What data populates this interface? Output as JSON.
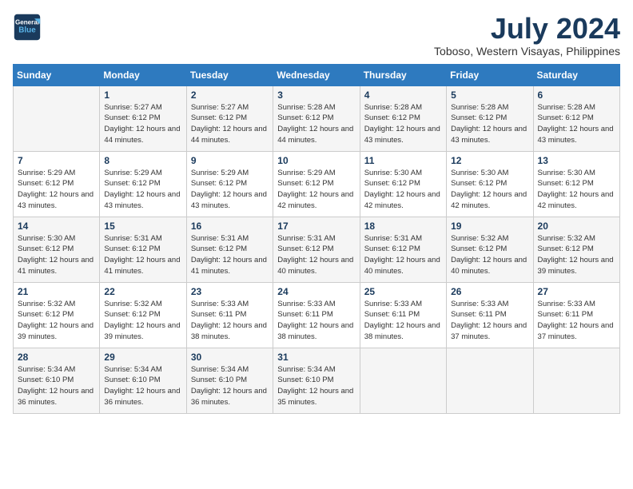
{
  "header": {
    "logo_line1": "General",
    "logo_line2": "Blue",
    "month_year": "July 2024",
    "location": "Toboso, Western Visayas, Philippines"
  },
  "days_of_week": [
    "Sunday",
    "Monday",
    "Tuesday",
    "Wednesday",
    "Thursday",
    "Friday",
    "Saturday"
  ],
  "weeks": [
    [
      {
        "day": "",
        "sunrise": "",
        "sunset": "",
        "daylight": ""
      },
      {
        "day": "1",
        "sunrise": "Sunrise: 5:27 AM",
        "sunset": "Sunset: 6:12 PM",
        "daylight": "Daylight: 12 hours and 44 minutes."
      },
      {
        "day": "2",
        "sunrise": "Sunrise: 5:27 AM",
        "sunset": "Sunset: 6:12 PM",
        "daylight": "Daylight: 12 hours and 44 minutes."
      },
      {
        "day": "3",
        "sunrise": "Sunrise: 5:28 AM",
        "sunset": "Sunset: 6:12 PM",
        "daylight": "Daylight: 12 hours and 44 minutes."
      },
      {
        "day": "4",
        "sunrise": "Sunrise: 5:28 AM",
        "sunset": "Sunset: 6:12 PM",
        "daylight": "Daylight: 12 hours and 43 minutes."
      },
      {
        "day": "5",
        "sunrise": "Sunrise: 5:28 AM",
        "sunset": "Sunset: 6:12 PM",
        "daylight": "Daylight: 12 hours and 43 minutes."
      },
      {
        "day": "6",
        "sunrise": "Sunrise: 5:28 AM",
        "sunset": "Sunset: 6:12 PM",
        "daylight": "Daylight: 12 hours and 43 minutes."
      }
    ],
    [
      {
        "day": "7",
        "sunrise": "Sunrise: 5:29 AM",
        "sunset": "Sunset: 6:12 PM",
        "daylight": "Daylight: 12 hours and 43 minutes."
      },
      {
        "day": "8",
        "sunrise": "Sunrise: 5:29 AM",
        "sunset": "Sunset: 6:12 PM",
        "daylight": "Daylight: 12 hours and 43 minutes."
      },
      {
        "day": "9",
        "sunrise": "Sunrise: 5:29 AM",
        "sunset": "Sunset: 6:12 PM",
        "daylight": "Daylight: 12 hours and 43 minutes."
      },
      {
        "day": "10",
        "sunrise": "Sunrise: 5:29 AM",
        "sunset": "Sunset: 6:12 PM",
        "daylight": "Daylight: 12 hours and 42 minutes."
      },
      {
        "day": "11",
        "sunrise": "Sunrise: 5:30 AM",
        "sunset": "Sunset: 6:12 PM",
        "daylight": "Daylight: 12 hours and 42 minutes."
      },
      {
        "day": "12",
        "sunrise": "Sunrise: 5:30 AM",
        "sunset": "Sunset: 6:12 PM",
        "daylight": "Daylight: 12 hours and 42 minutes."
      },
      {
        "day": "13",
        "sunrise": "Sunrise: 5:30 AM",
        "sunset": "Sunset: 6:12 PM",
        "daylight": "Daylight: 12 hours and 42 minutes."
      }
    ],
    [
      {
        "day": "14",
        "sunrise": "Sunrise: 5:30 AM",
        "sunset": "Sunset: 6:12 PM",
        "daylight": "Daylight: 12 hours and 41 minutes."
      },
      {
        "day": "15",
        "sunrise": "Sunrise: 5:31 AM",
        "sunset": "Sunset: 6:12 PM",
        "daylight": "Daylight: 12 hours and 41 minutes."
      },
      {
        "day": "16",
        "sunrise": "Sunrise: 5:31 AM",
        "sunset": "Sunset: 6:12 PM",
        "daylight": "Daylight: 12 hours and 41 minutes."
      },
      {
        "day": "17",
        "sunrise": "Sunrise: 5:31 AM",
        "sunset": "Sunset: 6:12 PM",
        "daylight": "Daylight: 12 hours and 40 minutes."
      },
      {
        "day": "18",
        "sunrise": "Sunrise: 5:31 AM",
        "sunset": "Sunset: 6:12 PM",
        "daylight": "Daylight: 12 hours and 40 minutes."
      },
      {
        "day": "19",
        "sunrise": "Sunrise: 5:32 AM",
        "sunset": "Sunset: 6:12 PM",
        "daylight": "Daylight: 12 hours and 40 minutes."
      },
      {
        "day": "20",
        "sunrise": "Sunrise: 5:32 AM",
        "sunset": "Sunset: 6:12 PM",
        "daylight": "Daylight: 12 hours and 39 minutes."
      }
    ],
    [
      {
        "day": "21",
        "sunrise": "Sunrise: 5:32 AM",
        "sunset": "Sunset: 6:12 PM",
        "daylight": "Daylight: 12 hours and 39 minutes."
      },
      {
        "day": "22",
        "sunrise": "Sunrise: 5:32 AM",
        "sunset": "Sunset: 6:12 PM",
        "daylight": "Daylight: 12 hours and 39 minutes."
      },
      {
        "day": "23",
        "sunrise": "Sunrise: 5:33 AM",
        "sunset": "Sunset: 6:11 PM",
        "daylight": "Daylight: 12 hours and 38 minutes."
      },
      {
        "day": "24",
        "sunrise": "Sunrise: 5:33 AM",
        "sunset": "Sunset: 6:11 PM",
        "daylight": "Daylight: 12 hours and 38 minutes."
      },
      {
        "day": "25",
        "sunrise": "Sunrise: 5:33 AM",
        "sunset": "Sunset: 6:11 PM",
        "daylight": "Daylight: 12 hours and 38 minutes."
      },
      {
        "day": "26",
        "sunrise": "Sunrise: 5:33 AM",
        "sunset": "Sunset: 6:11 PM",
        "daylight": "Daylight: 12 hours and 37 minutes."
      },
      {
        "day": "27",
        "sunrise": "Sunrise: 5:33 AM",
        "sunset": "Sunset: 6:11 PM",
        "daylight": "Daylight: 12 hours and 37 minutes."
      }
    ],
    [
      {
        "day": "28",
        "sunrise": "Sunrise: 5:34 AM",
        "sunset": "Sunset: 6:10 PM",
        "daylight": "Daylight: 12 hours and 36 minutes."
      },
      {
        "day": "29",
        "sunrise": "Sunrise: 5:34 AM",
        "sunset": "Sunset: 6:10 PM",
        "daylight": "Daylight: 12 hours and 36 minutes."
      },
      {
        "day": "30",
        "sunrise": "Sunrise: 5:34 AM",
        "sunset": "Sunset: 6:10 PM",
        "daylight": "Daylight: 12 hours and 36 minutes."
      },
      {
        "day": "31",
        "sunrise": "Sunrise: 5:34 AM",
        "sunset": "Sunset: 6:10 PM",
        "daylight": "Daylight: 12 hours and 35 minutes."
      },
      {
        "day": "",
        "sunrise": "",
        "sunset": "",
        "daylight": ""
      },
      {
        "day": "",
        "sunrise": "",
        "sunset": "",
        "daylight": ""
      },
      {
        "day": "",
        "sunrise": "",
        "sunset": "",
        "daylight": ""
      }
    ]
  ]
}
